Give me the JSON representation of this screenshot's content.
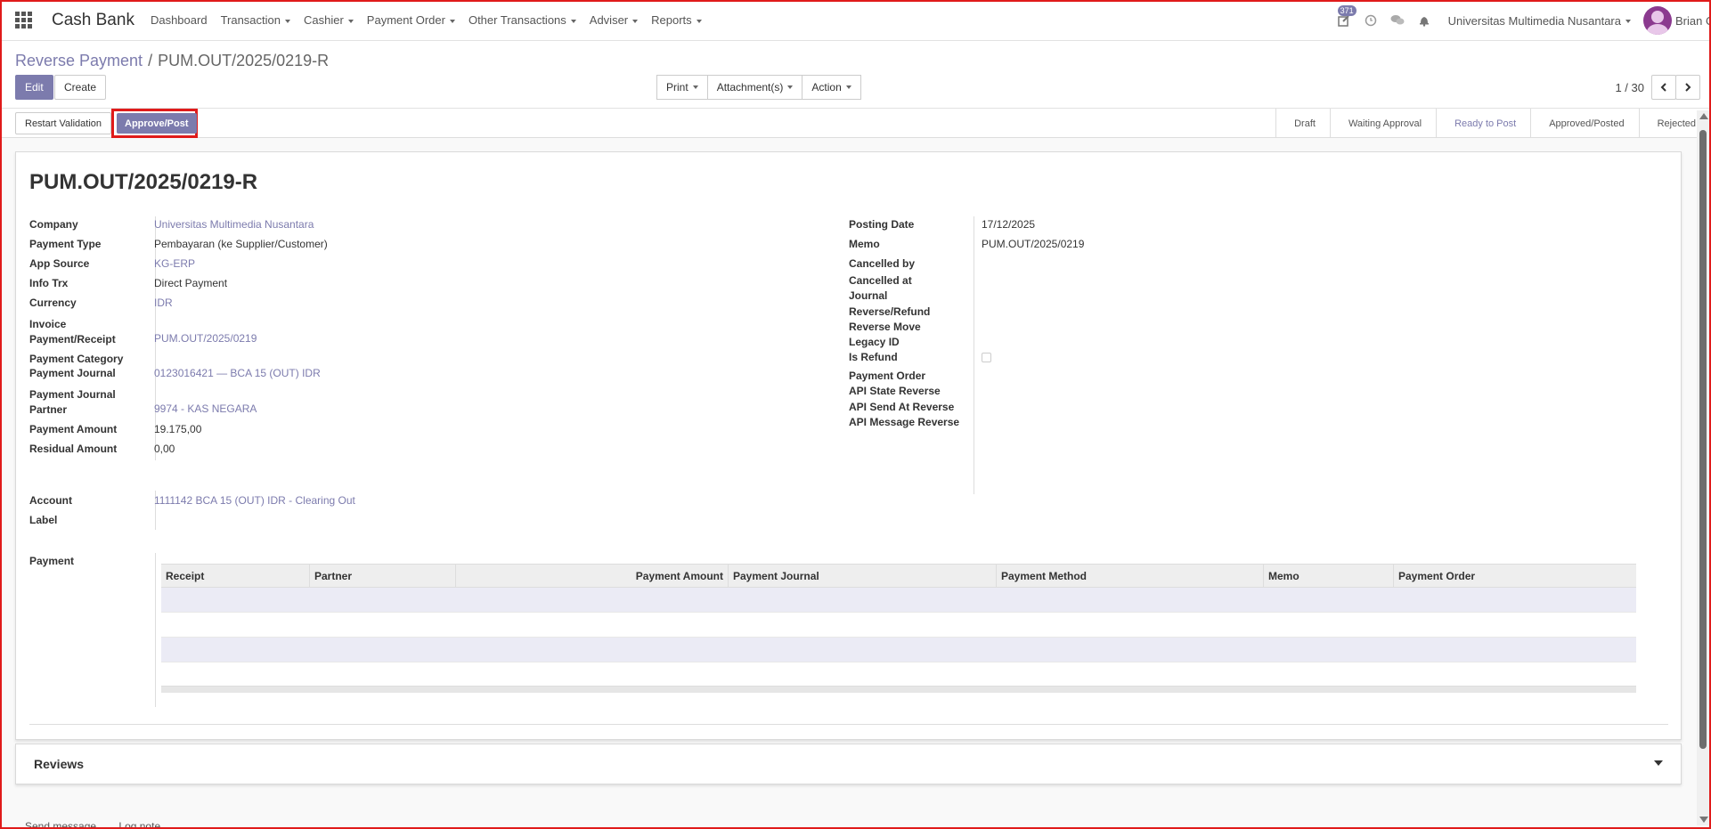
{
  "navbar": {
    "app_title": "Cash Bank",
    "menu": [
      {
        "label": "Dashboard",
        "dropdown": false
      },
      {
        "label": "Transaction",
        "dropdown": true
      },
      {
        "label": "Cashier",
        "dropdown": true
      },
      {
        "label": "Payment Order",
        "dropdown": true
      },
      {
        "label": "Other Transactions",
        "dropdown": true
      },
      {
        "label": "Adviser",
        "dropdown": true
      },
      {
        "label": "Reports",
        "dropdown": true
      }
    ],
    "activity_badge": "371",
    "company": "Universitas Multimedia Nusantara",
    "user": "Brian O"
  },
  "breadcrumb": {
    "parent": "Reverse Payment",
    "separator": "/",
    "current": "PUM.OUT/2025/0219-R"
  },
  "toolbar": {
    "edit_label": "Edit",
    "create_label": "Create",
    "print_label": "Print",
    "attachments_label": "Attachment(s)",
    "action_label": "Action"
  },
  "pager": {
    "value": "1 / 30"
  },
  "statusbar": {
    "restart_label": "Restart Validation",
    "approve_label": "Approve/Post",
    "stages": [
      "Draft",
      "Waiting Approval",
      "Ready to Post",
      "Approved/Posted",
      "Rejected"
    ],
    "active_stage": "Ready to Post"
  },
  "record": {
    "title": "PUM.OUT/2025/0219-R",
    "left_fields": [
      {
        "label": "Company",
        "value": "Universitas Multimedia Nusantara",
        "link": true
      },
      {
        "label": "Payment Type",
        "value": "Pembayaran (ke Supplier/Customer)",
        "link": false
      },
      {
        "label": "App Source",
        "value": "KG-ERP",
        "link": true
      },
      {
        "label": "Info Trx",
        "value": "Direct Payment",
        "link": false
      },
      {
        "label": "Currency",
        "value": "IDR",
        "link": true
      },
      {
        "label": "Invoice Payment/Receipt",
        "value": "PUM.OUT/2025/0219",
        "link": true
      },
      {
        "label": "Payment Category",
        "value": "",
        "link": false
      },
      {
        "label": "Payment Journal",
        "value": "0123016421 — BCA 15 (OUT) IDR",
        "link": true
      },
      {
        "label": "Payment Journal Partner",
        "value": "9974 - KAS NEGARA",
        "link": true
      },
      {
        "label": "Payment Amount",
        "value": "19.175,00",
        "link": false
      },
      {
        "label": "Residual Amount",
        "value": "0,00",
        "link": false
      }
    ],
    "right_fields": [
      {
        "label": "Posting Date",
        "value": "17/12/2025"
      },
      {
        "label": "Memo",
        "value": "PUM.OUT/2025/0219"
      },
      {
        "label": "Cancelled by",
        "value": ""
      },
      {
        "label": "Cancelled at Journal",
        "value": ""
      },
      {
        "label": "Reverse/Refund Reverse Move",
        "value": ""
      },
      {
        "label": "Legacy ID",
        "value": ""
      },
      {
        "label": "Is Refund",
        "value": ""
      },
      {
        "label": "Payment Order",
        "value": ""
      },
      {
        "label": "API State Reverse",
        "value": ""
      },
      {
        "label": "API Send At Reverse",
        "value": ""
      },
      {
        "label": "API Message Reverse",
        "value": ""
      }
    ],
    "account_label": "Account",
    "account_value": "1111142 BCA 15 (OUT) IDR - Clearing Out",
    "label_label": "Label",
    "label_value": "",
    "payment_label": "Payment",
    "payment_table": {
      "columns": [
        "Receipt",
        "Partner",
        "Payment Amount",
        "Payment Journal",
        "Payment Method",
        "Memo",
        "Payment Order"
      ],
      "rows": []
    }
  },
  "reviews": {
    "title": "Reviews"
  },
  "chatter": {
    "send_message": "Send message",
    "log_note": "Log note"
  }
}
